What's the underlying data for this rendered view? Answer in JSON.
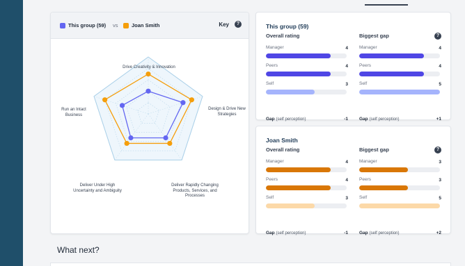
{
  "colors": {
    "group": "#6366f1",
    "person": "#f59e0b",
    "group_dark": "#4f46e5",
    "group_light": "#a5b4fc",
    "person_dark": "#d97706",
    "person_light": "#fcd9a8"
  },
  "radar": {
    "legend_group": "This group (59)",
    "legend_vs": "vs",
    "legend_person": "Joan Smith",
    "key_label": "Key",
    "axes": [
      "Drive Creativity & Innovation",
      "Design & Drive New Strategies",
      "Deliver Rapidly Changing Products, Services, and Processes",
      "Deliver Under High Uncertainty and Ambiguity",
      "Run an Intact Business"
    ],
    "group_scores": [
      2.0,
      3.2,
      2.6,
      2.6,
      2.4
    ],
    "person_scores": [
      3.5,
      4.0,
      3.2,
      3.2,
      4.0
    ],
    "max_score": 5
  },
  "group_card": {
    "title": "This group (59)",
    "overall_title": "Overall rating",
    "gap_title": "Biggest gap",
    "overall_rows": [
      {
        "label": "Manager",
        "value": "4",
        "fill": 0.8
      },
      {
        "label": "Peers",
        "value": "4",
        "fill": 0.8
      },
      {
        "label": "Self",
        "value": "3",
        "fill": 0.6
      }
    ],
    "gap_rows": [
      {
        "label": "Manager",
        "value": "4",
        "fill": 0.8
      },
      {
        "label": "Peers",
        "value": "4",
        "fill": 0.8
      },
      {
        "label": "Self",
        "value": "5",
        "fill": 1.0
      }
    ],
    "overall_gap_label": "Gap",
    "overall_gap_note": "(self perception)",
    "overall_gap_value": "-1",
    "biggest_gap_label": "Gap",
    "biggest_gap_note": "(self perception)",
    "biggest_gap_value": "+1"
  },
  "person_card": {
    "title": "Joan Smith",
    "overall_title": "Overall rating",
    "gap_title": "Biggest gap",
    "overall_rows": [
      {
        "label": "Manager",
        "value": "4",
        "fill": 0.8
      },
      {
        "label": "Peers",
        "value": "4",
        "fill": 0.8
      },
      {
        "label": "Self",
        "value": "3",
        "fill": 0.6
      }
    ],
    "gap_rows": [
      {
        "label": "Manager",
        "value": "3",
        "fill": 0.6
      },
      {
        "label": "Peers",
        "value": "3",
        "fill": 0.6
      },
      {
        "label": "Self",
        "value": "5",
        "fill": 1.0
      }
    ],
    "overall_gap_label": "Gap",
    "overall_gap_note": "(self perception)",
    "overall_gap_value": "-1",
    "biggest_gap_label": "Gap",
    "biggest_gap_note": "(self perception)",
    "biggest_gap_value": "+2"
  },
  "what_next": "What next?"
}
